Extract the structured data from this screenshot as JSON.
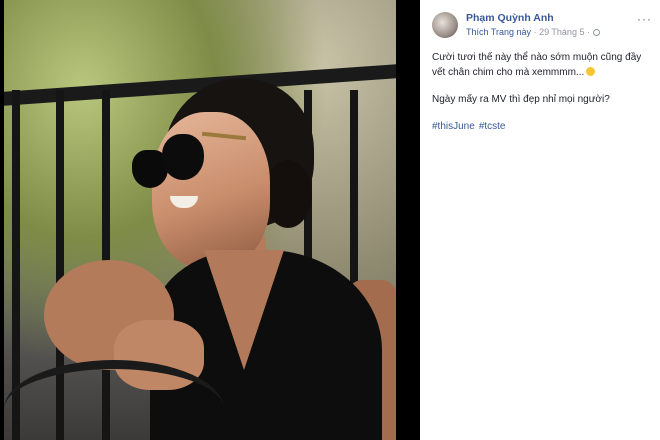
{
  "post": {
    "author": "Phạm Quỳnh Anh",
    "like_page": "Thích Trang này",
    "separator": "·",
    "date": "29 Tháng 5",
    "date_separator": "·",
    "more_label": "···",
    "text_line1": "Cười tươi thế này thể nào sớm muộn cũng đầy vết chân chim cho mà xemmmm...",
    "text_line2": "Ngày mấy ra MV thì đẹp nhỉ mọi người?",
    "hashtags": [
      "#thisJune",
      "#tcste"
    ]
  },
  "icons": {
    "privacy": "globe-icon",
    "emoji": "laughing-emoji-icon",
    "options": "more-options-icon"
  },
  "colors": {
    "link": "#385898",
    "meta": "#90949c",
    "text": "#1d2129",
    "panel_bg": "#ffffff",
    "viewer_bg": "#000000"
  }
}
